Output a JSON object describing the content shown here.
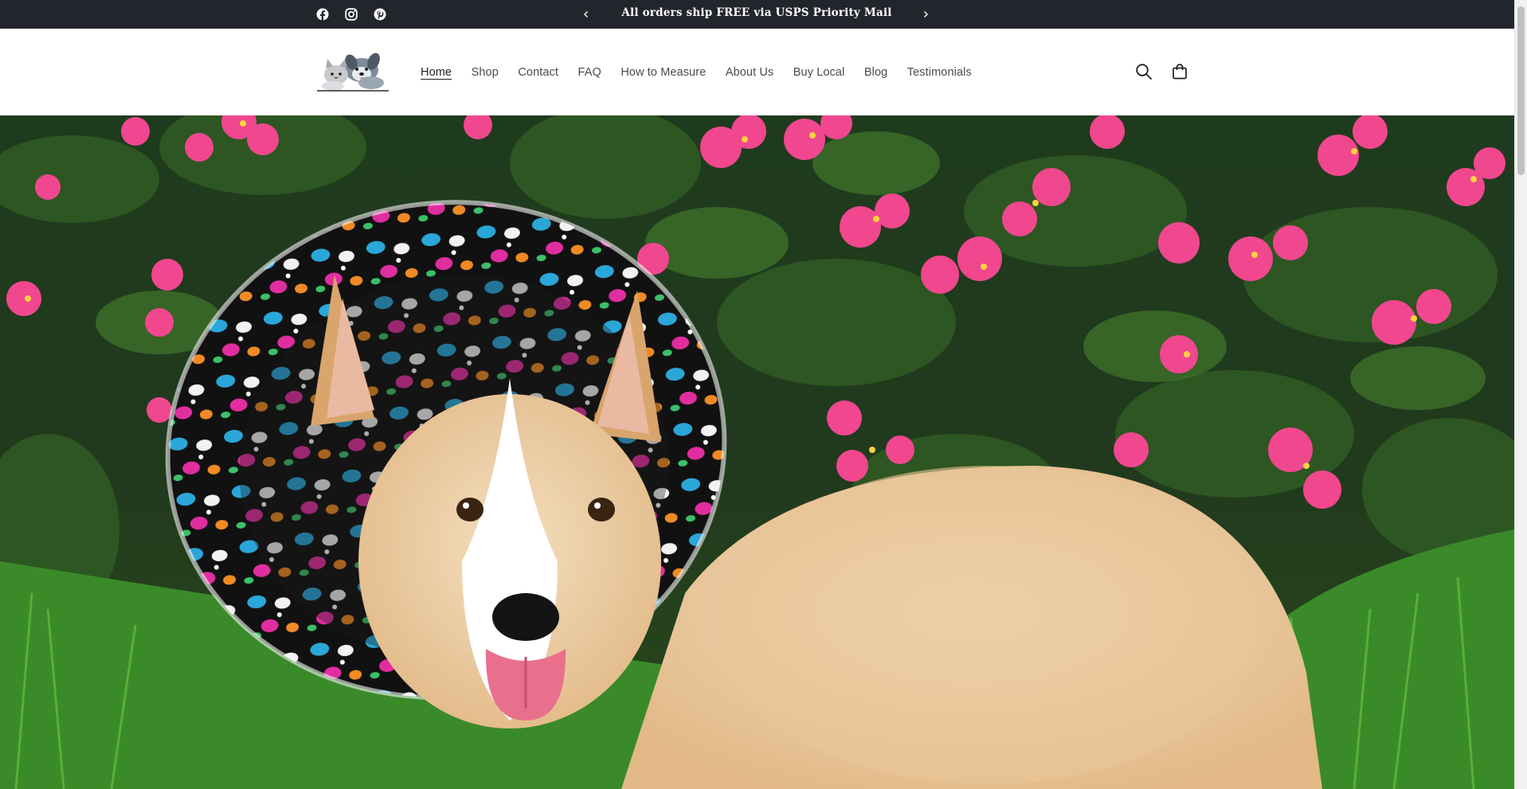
{
  "announcement": {
    "message": "All orders ship FREE via USPS Priority Mail",
    "prev_icon": "chevron-left-icon",
    "next_icon": "chevron-right-icon"
  },
  "social": [
    {
      "name": "Facebook",
      "icon": "facebook-icon"
    },
    {
      "name": "Instagram",
      "icon": "instagram-icon"
    },
    {
      "name": "Pinterest",
      "icon": "pinterest-icon"
    }
  ],
  "header": {
    "logo_icon": "dog-and-cat-logo",
    "nav": [
      {
        "label": "Home",
        "active": true
      },
      {
        "label": "Shop",
        "active": false
      },
      {
        "label": "Contact",
        "active": false
      },
      {
        "label": "FAQ",
        "active": false
      },
      {
        "label": "How to Measure",
        "active": false
      },
      {
        "label": "About Us",
        "active": false
      },
      {
        "label": "Buy Local",
        "active": false
      },
      {
        "label": "Blog",
        "active": false
      },
      {
        "label": "Testimonials",
        "active": false
      }
    ],
    "search_icon": "search-icon",
    "cart_icon": "cart-bag-icon"
  },
  "hero": {
    "image": "corgi-in-patterned-soft-cone-collar-in-garden"
  },
  "colors": {
    "announcement_bg": "#22252c",
    "header_bg": "#ffffff",
    "nav_text": "#4a4a4a"
  }
}
